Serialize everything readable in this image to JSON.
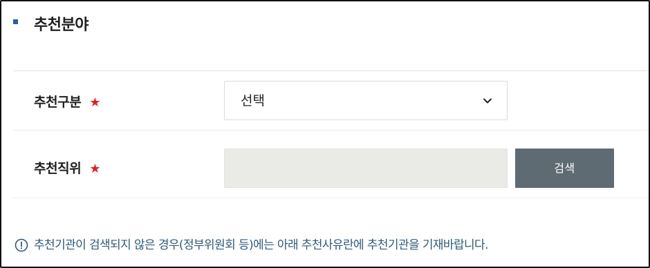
{
  "section": {
    "title": "추천분야"
  },
  "fields": {
    "category": {
      "label": "추천구분",
      "required_mark": "★",
      "selected_value": "선택"
    },
    "position": {
      "label": "추천직위",
      "required_mark": "★",
      "value": "",
      "search_button_label": "검색"
    }
  },
  "notice": {
    "text": "추천기관이 검색되지 않은 경우(정부위원회 등)에는 아래 추천사유란에 추천기관을 기재바랍니다."
  },
  "icons": {
    "section_bullet": "square-bullet-icon",
    "select_chevron": "chevron-down-icon",
    "notice": "info-circle-icon"
  },
  "colors": {
    "bullet": "#2f5d9c",
    "required_star": "#e02020",
    "notice_text": "#2d5a7b",
    "search_button_bg": "#5f6b73",
    "input_bg": "#eaeae6"
  }
}
